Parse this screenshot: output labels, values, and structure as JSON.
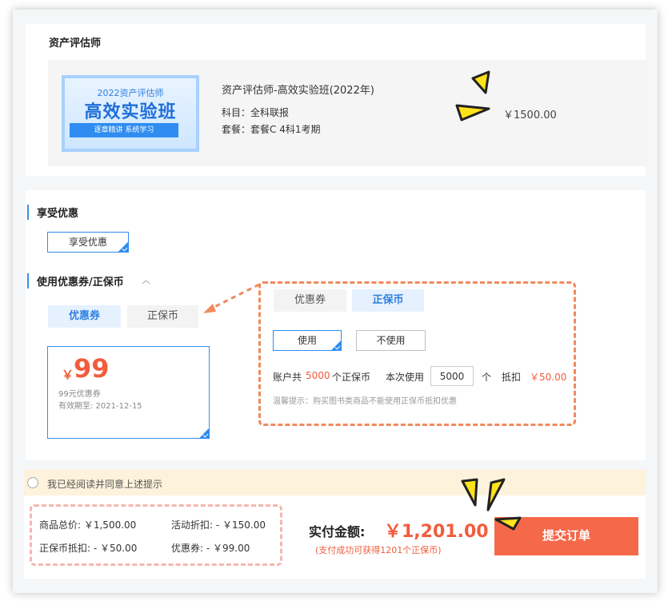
{
  "product": {
    "section_title": "资产评估师",
    "thumb_top": "2022资产评估师",
    "thumb_main": "高效实验班",
    "thumb_banner": "逐章精讲 系统学习",
    "name": "资产评估师-高效实验班(2022年)",
    "subject": "科目：全科联报",
    "package": "套餐：套餐C 4科1考期",
    "price": "￥1500.00"
  },
  "discount": {
    "title": "享受优惠",
    "option_label": "享受优惠"
  },
  "coupon_section": {
    "title": "使用优惠券/正保币",
    "tabs": [
      "优惠券",
      "正保币"
    ],
    "coupon": {
      "currency": "￥",
      "amount": "99",
      "desc": "99元优惠券",
      "valid": "有效期至:   2021-12-15"
    }
  },
  "callout": {
    "tabs": [
      "优惠券",
      "正保币"
    ],
    "use_label": "使用",
    "not_use_label": "不使用",
    "account_prefix": "账户共",
    "account_balance": "5000",
    "account_suffix": "个正保币",
    "use_prefix": "本次使用",
    "use_value": "5000",
    "use_unit": "个",
    "deduct_label": "抵扣",
    "deduct_value": "￥50.00",
    "tip": "温馨提示：购买图书类商品不能使用正保币抵扣优惠"
  },
  "agreement": {
    "text": "我已经阅读并同意上述提示"
  },
  "summary": {
    "goods_total": "商品总价: ￥1,500.00",
    "activity_discount": "活动折扣: - ￥150.00",
    "coin_deduct": "正保币抵扣: - ￥50.00",
    "coupon_deduct": "优惠券: - ￥99.00",
    "pay_label": "实付金额:",
    "pay_amount": "￥1,201.00",
    "pay_note": "(支付成功可获得1201个正保币)",
    "submit_label": "提交订单"
  },
  "colors": {
    "accent_blue": "#2f8cf0",
    "price_red": "#f25c3c",
    "submit_orange": "#f5684a",
    "agree_bg": "#fdf3dc"
  }
}
